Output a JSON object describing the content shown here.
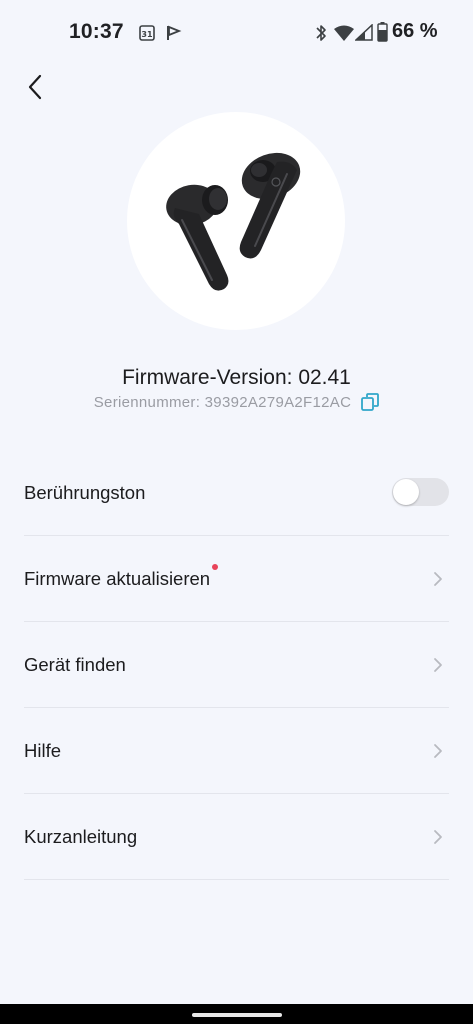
{
  "status_bar": {
    "time": "10:37",
    "calendar_day": "31",
    "battery": "66 %"
  },
  "device": {
    "firmware_version": "Firmware-Version: 02.41",
    "serial_number": "Seriennummer: 39392A279A2F12AC"
  },
  "menu": {
    "items": [
      {
        "label": "Berührungston",
        "control": "toggle",
        "toggle_on": false
      },
      {
        "label": "Firmware aktualisieren",
        "control": "chevron",
        "badge": "red-dot"
      },
      {
        "label": "Gerät finden",
        "control": "chevron"
      },
      {
        "label": "Hilfe",
        "control": "chevron"
      },
      {
        "label": "Kurzanleitung",
        "control": "chevron"
      }
    ]
  },
  "icons": {
    "back": "chevron-left-icon",
    "copy": "copy-icon",
    "chevron": "chevron-right-icon"
  },
  "colors": {
    "background": "#f4f6fc",
    "accent": "#2fa6c9",
    "badge": "#e8435a",
    "toggle_off": "#e2e3e8"
  }
}
